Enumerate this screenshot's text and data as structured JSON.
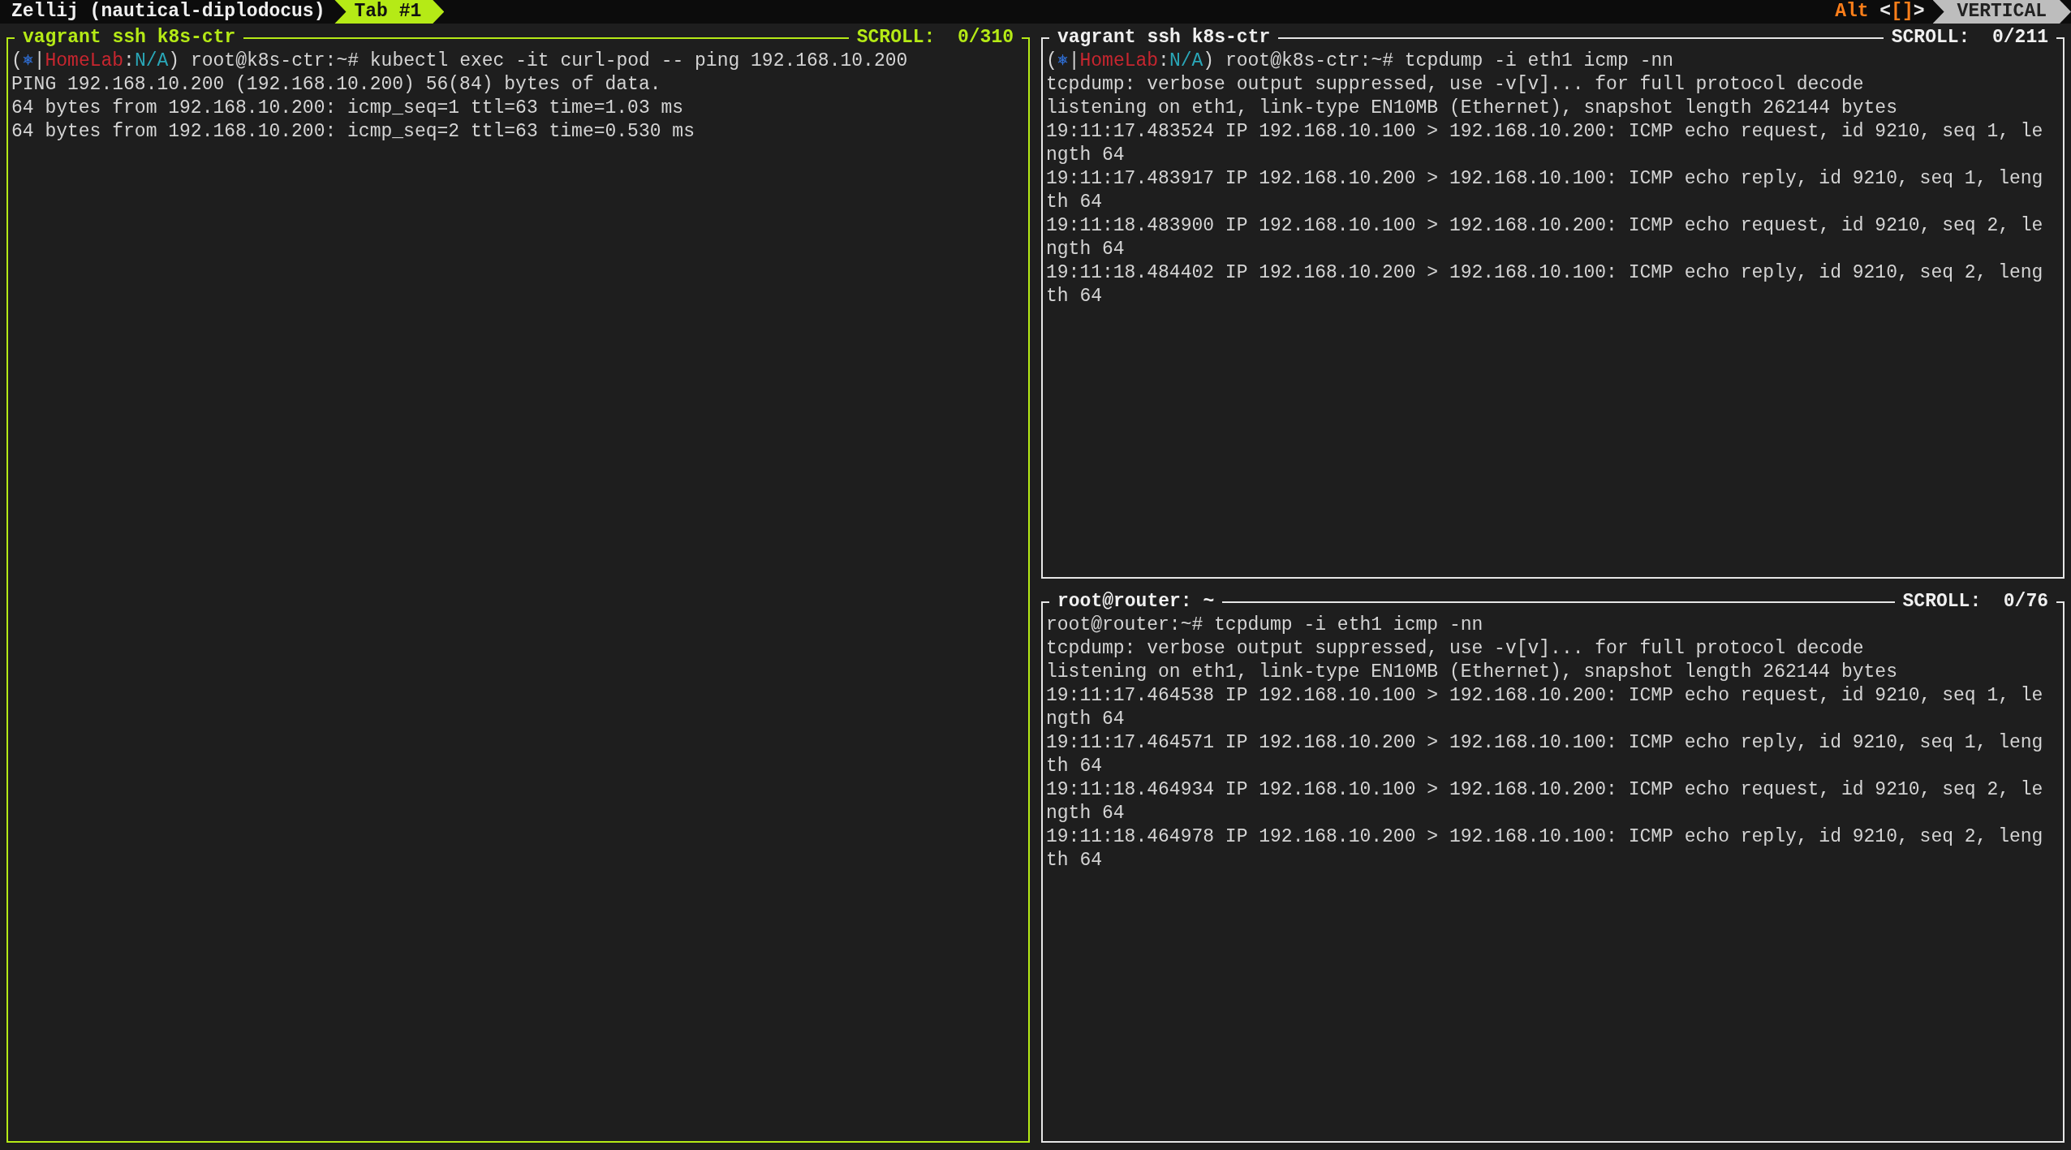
{
  "top_bar": {
    "session": "Zellij (nautical-diplodocus)",
    "tabs": [
      {
        "label": "Tab #1",
        "selected": true
      }
    ],
    "mode_keys": [
      {
        "text": "Alt",
        "color": "#ff7f1a"
      },
      {
        "text": " <",
        "color": "#e8e8e8"
      },
      {
        "text": "[]",
        "color": "#ff7f1a"
      },
      {
        "text": ">",
        "color": "#e8e8e8"
      }
    ],
    "mode": "VERTICAL"
  },
  "panes": [
    {
      "title": "vagrant ssh k8s-ctr",
      "scroll": "SCROLL:  0/310",
      "focused": true,
      "lines": [
        {
          "segments": [
            {
              "text": "(",
              "color": "#d4d4d4"
            },
            {
              "text": "⎈",
              "color": "#2f6fd6"
            },
            {
              "text": "|",
              "color": "#d4d4d4"
            },
            {
              "text": "HomeLab",
              "color": "#c8262f"
            },
            {
              "text": ":",
              "color": "#d4d4d4"
            },
            {
              "text": "N/A",
              "color": "#2aa7b8"
            },
            {
              "text": ") root@k8s-ctr:~# kubectl exec -it curl-pod -- ping 192.168.10.200",
              "color": "#d4d4d4"
            }
          ]
        },
        {
          "text": "PING 192.168.10.200 (192.168.10.200) 56(84) bytes of data."
        },
        {
          "text": "64 bytes from 192.168.10.200: icmp_seq=1 ttl=63 time=1.03 ms"
        },
        {
          "text": "64 bytes from 192.168.10.200: icmp_seq=2 ttl=63 time=0.530 ms"
        }
      ]
    },
    {
      "title": "vagrant ssh k8s-ctr",
      "scroll": "SCROLL:  0/211",
      "focused": false,
      "lines": [
        {
          "segments": [
            {
              "text": "(",
              "color": "#d4d4d4"
            },
            {
              "text": "⎈",
              "color": "#2f6fd6"
            },
            {
              "text": "|",
              "color": "#d4d4d4"
            },
            {
              "text": "HomeLab",
              "color": "#c8262f"
            },
            {
              "text": ":",
              "color": "#d4d4d4"
            },
            {
              "text": "N/A",
              "color": "#2aa7b8"
            },
            {
              "text": ") root@k8s-ctr:~# tcpdump -i eth1 icmp -nn",
              "color": "#d4d4d4"
            }
          ]
        },
        {
          "text": "tcpdump: verbose output suppressed, use -v[v]... for full protocol decode"
        },
        {
          "text": "listening on eth1, link-type EN10MB (Ethernet), snapshot length 262144 bytes"
        },
        {
          "text": "19:11:17.483524 IP 192.168.10.100 > 192.168.10.200: ICMP echo request, id 9210, seq 1, le"
        },
        {
          "text": "ngth 64"
        },
        {
          "text": "19:11:17.483917 IP 192.168.10.200 > 192.168.10.100: ICMP echo reply, id 9210, seq 1, leng"
        },
        {
          "text": "th 64"
        },
        {
          "text": "19:11:18.483900 IP 192.168.10.100 > 192.168.10.200: ICMP echo request, id 9210, seq 2, le"
        },
        {
          "text": "ngth 64"
        },
        {
          "text": "19:11:18.484402 IP 192.168.10.200 > 192.168.10.100: ICMP echo reply, id 9210, seq 2, leng"
        },
        {
          "text": "th 64"
        }
      ]
    },
    {
      "title": "root@router: ~",
      "scroll": "SCROLL:  0/76",
      "focused": false,
      "lines": [
        {
          "text": "root@router:~# tcpdump -i eth1 icmp -nn"
        },
        {
          "text": "tcpdump: verbose output suppressed, use -v[v]... for full protocol decode"
        },
        {
          "text": "listening on eth1, link-type EN10MB (Ethernet), snapshot length 262144 bytes"
        },
        {
          "text": "19:11:17.464538 IP 192.168.10.100 > 192.168.10.200: ICMP echo request, id 9210, seq 1, le"
        },
        {
          "text": "ngth 64"
        },
        {
          "text": "19:11:17.464571 IP 192.168.10.200 > 192.168.10.100: ICMP echo reply, id 9210, seq 1, leng"
        },
        {
          "text": "th 64"
        },
        {
          "text": "19:11:18.464934 IP 192.168.10.100 > 192.168.10.200: ICMP echo request, id 9210, seq 2, le"
        },
        {
          "text": "ngth 64"
        },
        {
          "text": "19:11:18.464978 IP 192.168.10.200 > 192.168.10.100: ICMP echo reply, id 9210, seq 2, leng"
        },
        {
          "text": "th 64"
        }
      ]
    }
  ]
}
